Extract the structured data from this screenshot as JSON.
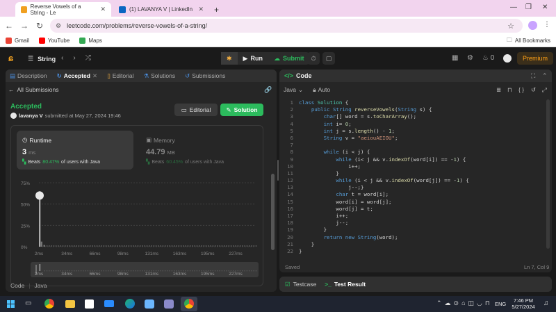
{
  "browser": {
    "tabs": [
      {
        "title": "Reverse Vowels of a String - Le",
        "active": true
      },
      {
        "title": "(1) LAVANYA V | LinkedIn",
        "active": false
      }
    ],
    "new_tab": "+",
    "url": "leetcode.com/problems/reverse-vowels-of-a-string/",
    "bookmarks": [
      "Gmail",
      "YouTube",
      "Maps"
    ],
    "all_bookmarks": "All Bookmarks"
  },
  "header": {
    "list_name": "String",
    "run_label": "Run",
    "submit_label": "Submit",
    "streak": "0",
    "premium_label": "Premium"
  },
  "left": {
    "tabs": [
      "Description",
      "Accepted",
      "Editorial",
      "Solutions",
      "Submissions"
    ],
    "all_submissions": "All Submissions",
    "status": "Accepted",
    "username": "lavanya V",
    "submitted_at": "submitted at May 27, 2024 19:46",
    "editorial_btn": "Editorial",
    "solution_btn": "Solution",
    "runtime": {
      "title": "Runtime",
      "value": "3",
      "unit": "ms",
      "beats_label": "Beats",
      "beats_pct": "80.47%",
      "beats_suffix": "of users with Java"
    },
    "memory": {
      "title": "Memory",
      "value": "44.79",
      "unit": "MB",
      "beats_label": "Beats",
      "beats_pct": "60.45%",
      "beats_suffix": "of users with Java"
    },
    "footer_lang": [
      "Code",
      "Java"
    ]
  },
  "chart_data": {
    "type": "bar",
    "ylabel_ticks": [
      "75%",
      "50%",
      "25%",
      "0%"
    ],
    "yticks": [
      75,
      50,
      25,
      0
    ],
    "ylim": [
      0,
      75
    ],
    "xticks": [
      "2ms",
      "34ms",
      "66ms",
      "98ms",
      "131ms",
      "163ms",
      "195ms",
      "227ms"
    ],
    "xlim": [
      2,
      250
    ],
    "highlight_x": 2,
    "highlight_pct": 60,
    "distribution": [
      {
        "x": 3,
        "pct": 65
      },
      {
        "x": 5,
        "pct": 6
      },
      {
        "x": 8,
        "pct": 2
      }
    ]
  },
  "editor": {
    "title": "Code",
    "language": "Java",
    "auto": "Auto",
    "lines": [
      "class Solution {",
      "    public String reverseVowels(String s) {",
      "        char[] word = s.toCharArray();",
      "        int i= 0;",
      "        int j = s.length() - 1;",
      "        String v = \"aeiouAEIOU\";",
      "",
      "        while (i < j) {",
      "            while (i< j && v.indexOf(word[i]) == -1) {",
      "                i++;",
      "            }",
      "            while (i < j && v.indexOf(word[j]) == -1) {",
      "                j--;}",
      "            char t = word[i];",
      "            word[i] = word[j];",
      "            word[j] = t;",
      "            i++;",
      "            j--;",
      "        }",
      "        return new String(word);",
      "    }",
      "}"
    ],
    "saved": "Saved",
    "cursor": "Ln 7, Col 9"
  },
  "bottom": {
    "testcase": "Testcase",
    "test_result": "Test Result"
  },
  "taskbar": {
    "lang": "ENG",
    "time": "7:46 PM",
    "date": "5/27/2024"
  }
}
